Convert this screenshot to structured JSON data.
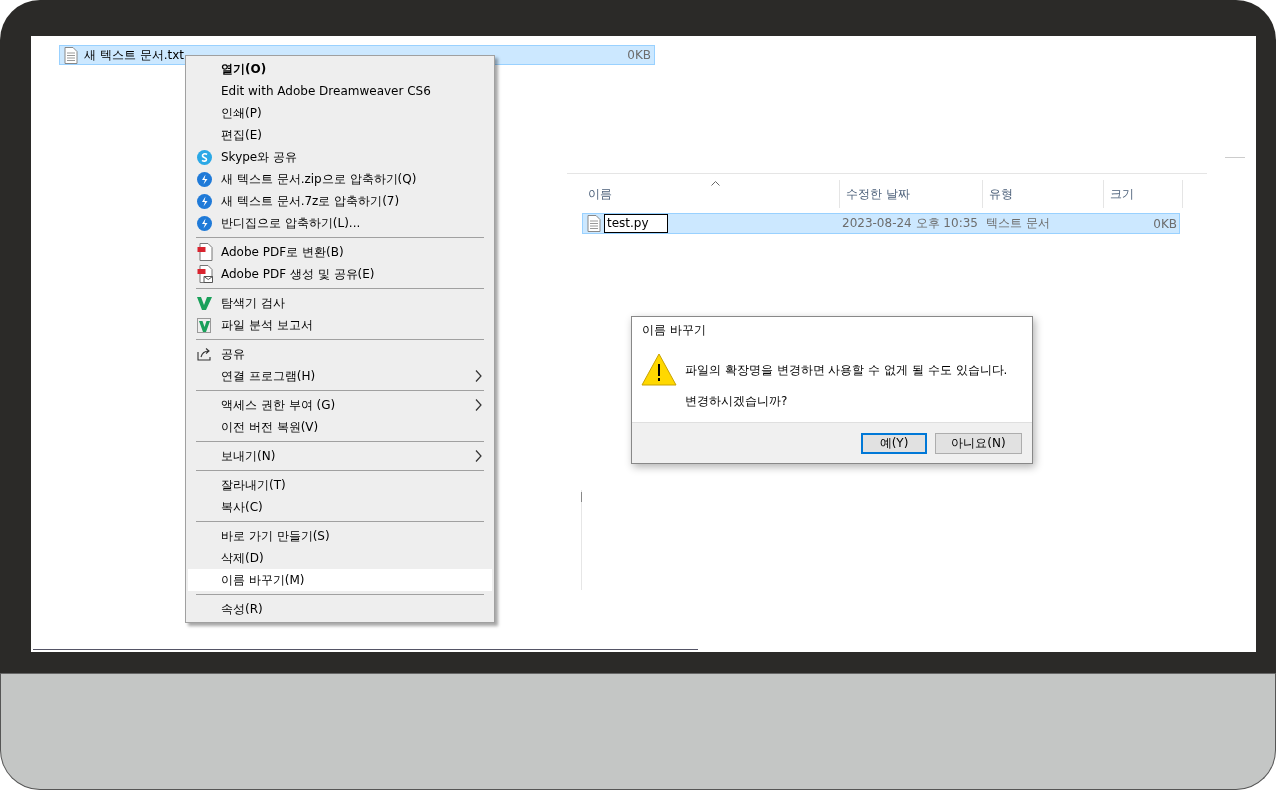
{
  "background_window": {
    "file_row": {
      "name": "새 텍스트 문서.txt",
      "size": "0KB",
      "selected": true
    }
  },
  "context_menu": {
    "groups": [
      [
        {
          "label": "열기(O)",
          "bold": true,
          "kind": "plain",
          "submenu": false,
          "selected": false
        },
        {
          "label": "Edit with Adobe Dreamweaver CS6",
          "bold": false,
          "kind": "plain",
          "submenu": false,
          "selected": false
        },
        {
          "label": "인쇄(P)",
          "bold": false,
          "kind": "plain",
          "submenu": false,
          "selected": false
        },
        {
          "label": "편집(E)",
          "bold": false,
          "kind": "plain",
          "submenu": false,
          "selected": false
        },
        {
          "label": "Skype와 공유",
          "bold": false,
          "kind": "chat",
          "submenu": false,
          "selected": false
        },
        {
          "label": "새 텍스트 문서.zip으로 압축하기(Q)",
          "bold": false,
          "kind": "archive",
          "submenu": false,
          "selected": false
        },
        {
          "label": "새 텍스트 문서.7z로 압축하기(7)",
          "bold": false,
          "kind": "archive",
          "submenu": false,
          "selected": false
        },
        {
          "label": "반디집으로 압축하기(L)...",
          "bold": false,
          "kind": "archive",
          "submenu": false,
          "selected": false
        }
      ],
      [
        {
          "label": "Adobe PDF로 변환(B)",
          "bold": false,
          "kind": "convert",
          "submenu": false,
          "selected": false
        },
        {
          "label": "Adobe PDF 생성 및 공유(E)",
          "bold": false,
          "kind": "mail",
          "submenu": false,
          "selected": false
        }
      ],
      [
        {
          "label": "탐색기 검사",
          "bold": false,
          "kind": "scan",
          "submenu": false,
          "selected": false
        },
        {
          "label": "파일 분석 보고서",
          "bold": false,
          "kind": "report",
          "submenu": false,
          "selected": false
        }
      ],
      [
        {
          "label": "공유",
          "bold": false,
          "kind": "share",
          "submenu": false,
          "selected": false
        },
        {
          "label": "연결 프로그램(H)",
          "bold": false,
          "kind": "plain",
          "submenu": true,
          "selected": false
        }
      ],
      [
        {
          "label": "액세스 권한 부여 (G)",
          "bold": false,
          "kind": "plain",
          "submenu": true,
          "selected": false
        },
        {
          "label": "이전 버전 복원(V)",
          "bold": false,
          "kind": "plain",
          "submenu": false,
          "selected": false
        }
      ],
      [
        {
          "label": "보내기(N)",
          "bold": false,
          "kind": "plain",
          "submenu": true,
          "selected": false
        }
      ],
      [
        {
          "label": "잘라내기(T)",
          "bold": false,
          "kind": "plain",
          "submenu": false,
          "selected": false
        },
        {
          "label": "복사(C)",
          "bold": false,
          "kind": "plain",
          "submenu": false,
          "selected": false
        }
      ],
      [
        {
          "label": "바로 가기 만들기(S)",
          "bold": false,
          "kind": "plain",
          "submenu": false,
          "selected": false
        },
        {
          "label": "삭제(D)",
          "bold": false,
          "kind": "plain",
          "submenu": false,
          "selected": false
        },
        {
          "label": "이름 바꾸기(M)",
          "bold": false,
          "kind": "plain",
          "submenu": false,
          "selected": true
        }
      ],
      [
        {
          "label": "속성(R)",
          "bold": false,
          "kind": "plain",
          "submenu": false,
          "selected": false
        }
      ]
    ]
  },
  "explorer": {
    "columns": [
      {
        "label": "이름",
        "sorted": true
      },
      {
        "label": "수정한 날짜",
        "sorted": false
      },
      {
        "label": "유형",
        "sorted": false
      },
      {
        "label": "크기",
        "sorted": false
      }
    ],
    "rows": [
      {
        "name": "test.py",
        "date": "2023-08-24 오후 10:35",
        "type": "텍스트 문서",
        "size": "0KB",
        "selected": true,
        "editing": true
      }
    ]
  },
  "dialog": {
    "title": "이름 바꾸기",
    "message": "파일의 확장명을 변경하면 사용할 수 없게 될 수도 있습니다.",
    "question": "변경하시겠습니까?",
    "buttons": [
      {
        "label": "예(Y)",
        "default": true
      },
      {
        "label": "아니요(N)",
        "default": false
      }
    ]
  }
}
